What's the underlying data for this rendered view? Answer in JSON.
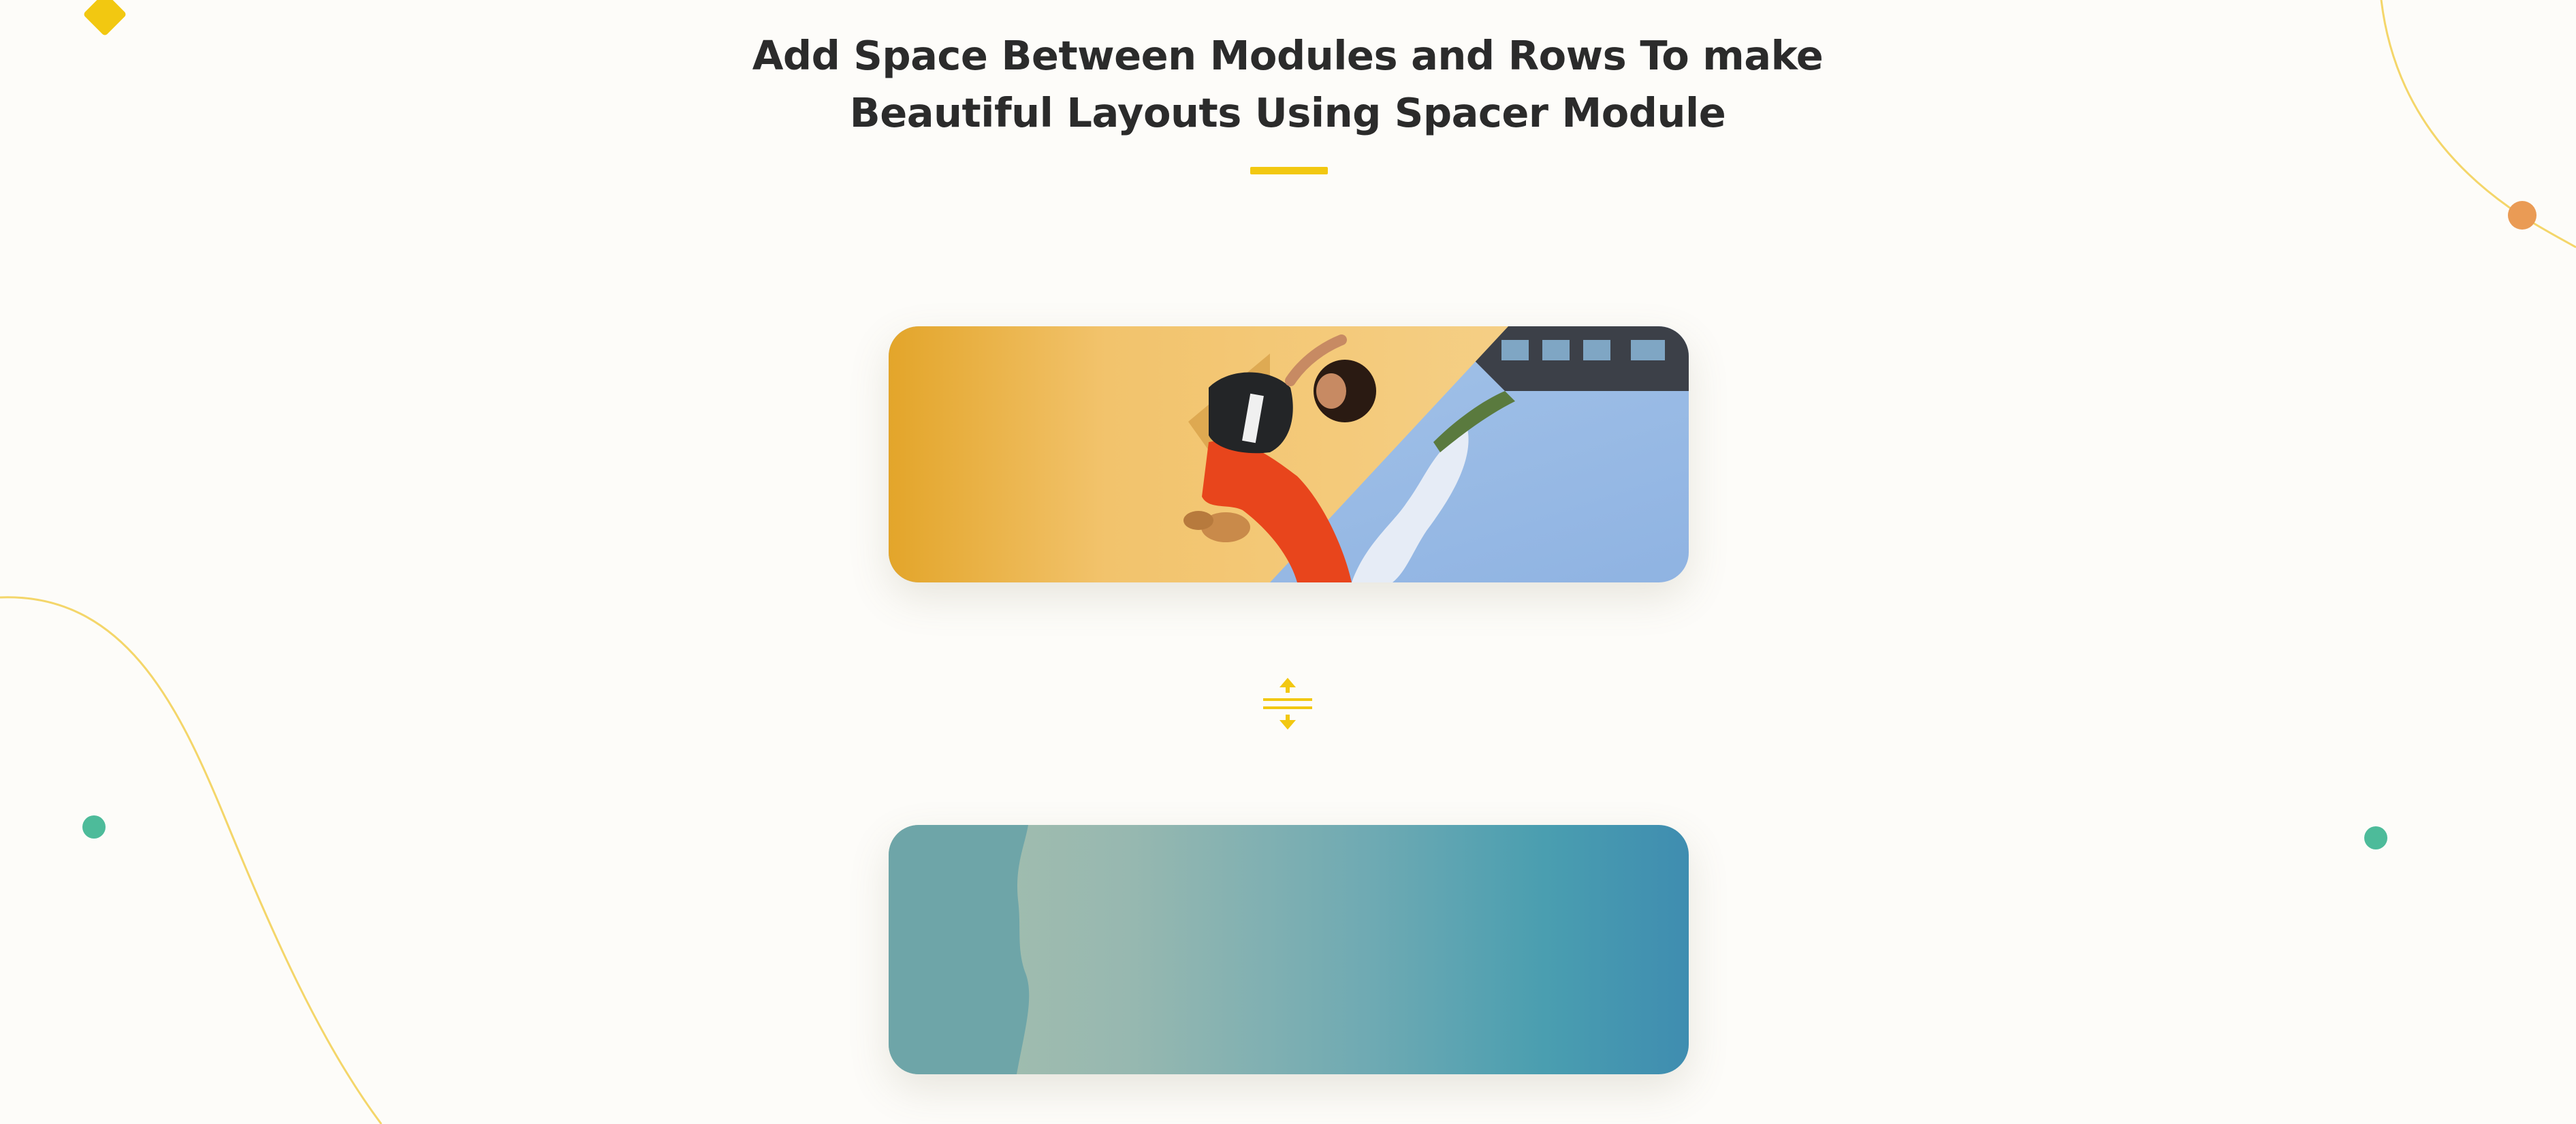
{
  "section": {
    "heading_line1": "Add Space Between Modules and Rows To make",
    "heading_line2": "Beautiful Layouts Using Spacer Module"
  },
  "modules": {
    "top_image": {
      "subject": "person in orange pants leaning on a yellow wall against blue sky and building"
    },
    "spacer": {
      "icon": "spacer-arrows-icon"
    },
    "bottom_image": {
      "subject": "teal gradient sea and sky scene"
    }
  },
  "decorations": {
    "icons": [
      "diamond-shape",
      "curve-line",
      "orange-dot",
      "green-dot"
    ]
  },
  "colors": {
    "background": "#fdfcf9",
    "heading": "#2b2b2b",
    "accent_yellow": "#f2c811",
    "accent_orange": "#ea9b55",
    "accent_green": "#4dbb9a",
    "curve_line": "#f4d66a"
  }
}
